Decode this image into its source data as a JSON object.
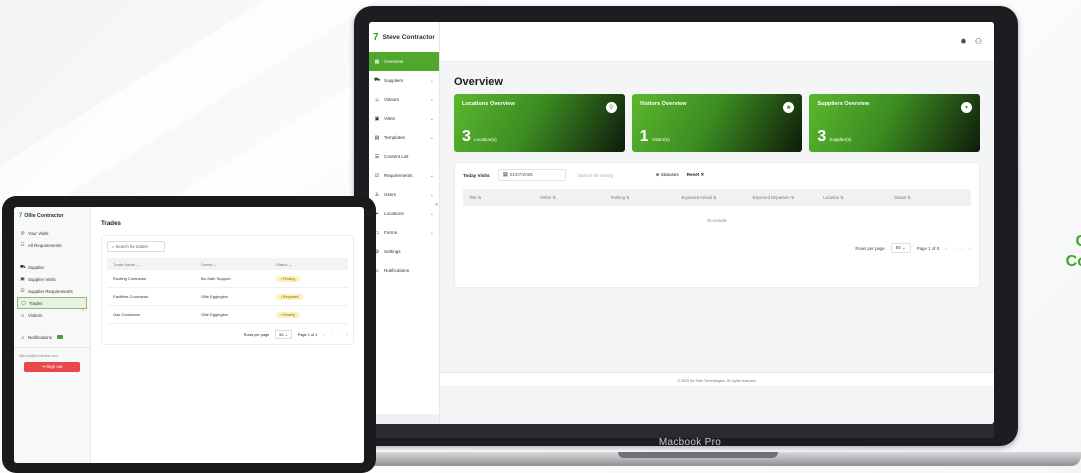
{
  "laptop": {
    "device_label": "Macbook Pro",
    "brand": "Steve Contractor",
    "nav": [
      {
        "label": "Overview",
        "icon": "grid-icon",
        "active": true,
        "chevron": false
      },
      {
        "label": "Suppliers",
        "icon": "truck-icon",
        "chevron": true
      },
      {
        "label": "Visitors",
        "icon": "people-icon",
        "chevron": true
      },
      {
        "label": "Visits",
        "icon": "calendar-icon",
        "chevron": true
      },
      {
        "label": "Templates",
        "icon": "template-icon",
        "chevron": true
      },
      {
        "label": "Content List",
        "icon": "list-icon",
        "chevron": false
      },
      {
        "label": "Requirements",
        "icon": "checklist-icon",
        "chevron": true
      },
      {
        "label": "Users",
        "icon": "user-icon",
        "chevron": true
      },
      {
        "label": "Locations",
        "icon": "pin-icon",
        "chevron": true
      },
      {
        "label": "Forms",
        "icon": "form-icon",
        "chevron": true
      },
      {
        "label": "Settings",
        "icon": "gear-icon",
        "chevron": false
      },
      {
        "label": "Notifications",
        "icon": "bell-icon",
        "chevron": false
      }
    ],
    "page_title": "Overview",
    "cards": [
      {
        "title": "Locations Overview",
        "value": "3",
        "unit": "Location(s)",
        "icon": "location-icon"
      },
      {
        "title": "Visitors Overview",
        "value": "1",
        "unit": "Visitor(s)",
        "icon": "visitors-icon"
      },
      {
        "title": "Suppliers Overview",
        "value": "3",
        "unit": "Supplier(s)",
        "icon": "supplier-icon"
      }
    ],
    "filters": {
      "today_visits": "Today Visits",
      "date": "01/07/2025",
      "search_placeholder": "Search for visit(s)",
      "statuses": "Statuses",
      "reset": "Reset"
    },
    "columns": [
      "Title",
      "Visitor",
      "Parking",
      "Expected Arrival",
      "Expected Departure",
      "Location",
      "Status"
    ],
    "empty_text": "No results",
    "pager": {
      "rows_label": "Rows per page",
      "rows_value": "50",
      "page_text": "Page 1 of 0"
    },
    "footer": "© 2025 Be-Safe Technologies. All rights reserved."
  },
  "tablet": {
    "brand": "Ollie Contractor",
    "nav_top": [
      {
        "label": "Your Visits",
        "icon": "visit-icon"
      },
      {
        "label": "All Requirements",
        "icon": "requirements-icon"
      }
    ],
    "nav_mid": [
      {
        "label": "Supplier",
        "icon": "truck-icon"
      },
      {
        "label": "Supplier Visits",
        "icon": "calendar-icon"
      },
      {
        "label": "Supplier Requirements",
        "icon": "checklist-icon"
      },
      {
        "label": "Trades",
        "icon": "trades-icon",
        "active": true
      },
      {
        "label": "Visitors",
        "icon": "people-icon"
      }
    ],
    "notifications": "Notifications",
    "email": "ollie.ford@be-safetech.com",
    "sign_out": "Sign out",
    "page_title": "Trades",
    "search_placeholder": "Search for trades",
    "columns": [
      "Trade Name",
      "Owner",
      "Status"
    ],
    "rows": [
      {
        "name": "Roofing Contractor",
        "owner": "Be-Safe Support",
        "status": "Pending"
      },
      {
        "name": "Facilities Contractor",
        "owner": "Ollie Eggington",
        "status": "Requested"
      },
      {
        "name": "Gas Contractor",
        "owner": "Ollie Eggington",
        "status": "Pending"
      }
    ],
    "pager": {
      "rows_label": "Rows per page",
      "rows_value": "50",
      "page_text": "Page 1 of 1"
    }
  },
  "side_headline": {
    "line1": "C",
    "line2": "Co"
  }
}
